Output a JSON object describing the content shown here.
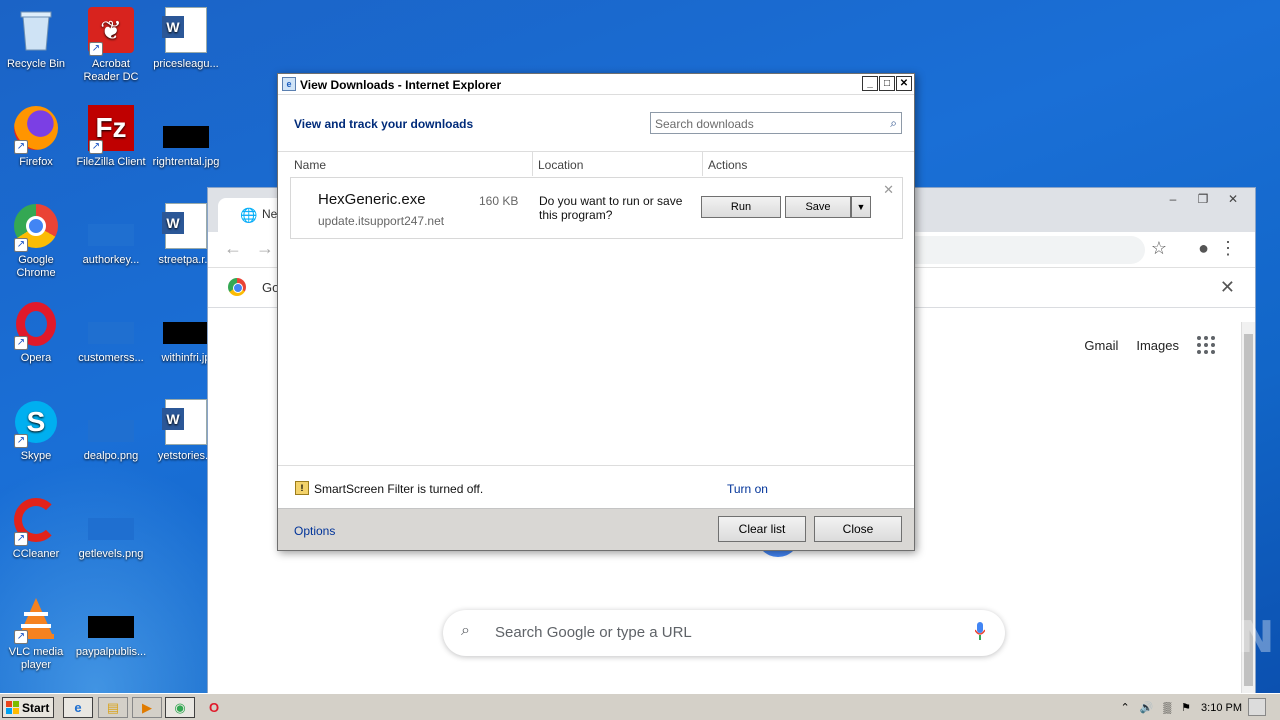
{
  "desktop": {
    "icons": [
      {
        "label": "Recycle Bin",
        "icon": "recycle-bin-icon"
      },
      {
        "label": "Acrobat Reader DC",
        "icon": "acrobat-icon"
      },
      {
        "label": "pricesleagu...",
        "icon": "word-doc-icon"
      },
      {
        "label": "Firefox",
        "icon": "firefox-icon"
      },
      {
        "label": "FileZilla Client",
        "icon": "filezilla-icon"
      },
      {
        "label": "rightrental.jpg",
        "icon": "image-file-icon"
      },
      {
        "label": "Google Chrome",
        "icon": "chrome-icon"
      },
      {
        "label": "authorkey...",
        "icon": "image-file-icon"
      },
      {
        "label": "streetpa.r...",
        "icon": "word-doc-icon"
      },
      {
        "label": "Opera",
        "icon": "opera-icon"
      },
      {
        "label": "customerss...",
        "icon": "image-file-icon"
      },
      {
        "label": "withinfri.jp",
        "icon": "image-file-icon"
      },
      {
        "label": "Skype",
        "icon": "skype-icon"
      },
      {
        "label": "dealpo.png",
        "icon": "image-file-icon"
      },
      {
        "label": "yetstories...",
        "icon": "word-doc-icon"
      },
      {
        "label": "CCleaner",
        "icon": "ccleaner-icon"
      },
      {
        "label": "getlevels.png",
        "icon": "image-file-icon"
      },
      {
        "label": "VLC media player",
        "icon": "vlc-icon"
      },
      {
        "label": "paypalpublis...",
        "icon": "image-file-icon"
      }
    ]
  },
  "chrome": {
    "tab_label": "New",
    "infobar_text": "Go",
    "links": {
      "gmail": "Gmail",
      "images": "Images"
    },
    "search_placeholder": "Search Google or type a URL"
  },
  "dialog": {
    "title": "View Downloads - Internet Explorer",
    "header": "View and track your downloads",
    "search_placeholder": "Search downloads",
    "columns": {
      "name": "Name",
      "location": "Location",
      "actions": "Actions"
    },
    "download": {
      "filename": "HexGeneric.exe",
      "source": "update.itsupport247.net",
      "size": "160 KB",
      "prompt": "Do you want to run or save this program?",
      "run_label": "Run",
      "save_label": "Save"
    },
    "smartscreen": {
      "message": "SmartScreen Filter is turned off.",
      "link": "Turn on"
    },
    "footer": {
      "options": "Options",
      "clear_list": "Clear list",
      "close": "Close"
    }
  },
  "watermark": "ANY RUN",
  "taskbar": {
    "start_label": "Start",
    "clock": "3:10 PM"
  }
}
